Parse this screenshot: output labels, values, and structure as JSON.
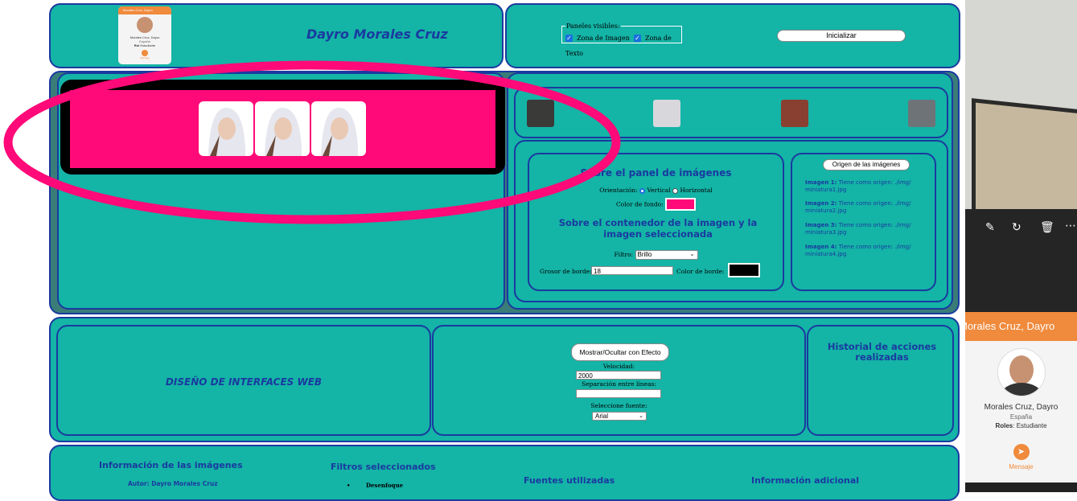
{
  "header": {
    "name_title": "Dayro Morales Cruz",
    "mini_card": {
      "bar": "Morales Cruz, Dayro",
      "name": "Morales Cruz, Dayro",
      "country": "España",
      "roles_label": "Rol",
      "roles_value": "Estudiante",
      "msg": "Mensaje"
    },
    "panels_legend": "Paneles visibles:",
    "zone_image": "Zona de Imagen",
    "zone_text": "Zona de Texto",
    "init_button": "Inicializar"
  },
  "image_panel": {
    "bg_color": "#ff0a78"
  },
  "settings": {
    "panel_title": "Sobre el panel de imágenes",
    "orientation_label": "Orientación:",
    "vertical": "Vertical",
    "horizontal": "Horizontal",
    "bgcolor_label": "Color de fondo:",
    "container_title": "Sobre el contenedor de la imagen y la imagen seleccionada",
    "filter_label": "Filtro:",
    "filter_value": "Brillo",
    "border_width_label": "Grosor de borde:",
    "border_width_value": "18",
    "border_color_label": "Color de borde:"
  },
  "origin": {
    "button": "Origen de las imágenes",
    "items": [
      {
        "label": "Imagen 1:",
        "text": "Tiene como origen: ./img/ miniatura1.jpg"
      },
      {
        "label": "Imagen 2:",
        "text": "Tiene como origen: ./img/ miniatura2.jpg"
      },
      {
        "label": "Imagen 3:",
        "text": "Tiene como origen: ./img/ miniatura3.jpg"
      },
      {
        "label": "Imagen 4:",
        "text": "Tiene como origen: ./img/ miniatura4.jpg"
      }
    ]
  },
  "middle": {
    "course_title": "DISEÑO DE INTERFACES WEB",
    "toggle_button": "Mostrar/Ocultar con Efecto",
    "speed_label": "Velocidad:",
    "speed_value": "2000",
    "line_sep_label": "Separación entre líneas:",
    "font_label": "Seleccione fuente:",
    "font_value": "Arial",
    "history_title": "Historial de acciones realizadas"
  },
  "bottom": {
    "info_title": "Información de las imágenes",
    "author": "Autor: Dayro Morales Cruz",
    "filters_title": "Filtros seleccionados",
    "filter_item": "Desenfoque",
    "fonts_title": "Fuentes utilizadas",
    "extra_title": "Información adicional"
  },
  "side_card": {
    "bar_title": "Morales Cruz, Dayro",
    "name": "Morales Cruz, Dayro",
    "country": "España",
    "roles_label": "Roles",
    "roles_value": "Estudiante",
    "message": "Mensaje",
    "accent": "#f08a3c"
  },
  "colors": {
    "teal": "#14b4a6",
    "navy": "#1a3aa0",
    "pink": "#ff0a78"
  }
}
